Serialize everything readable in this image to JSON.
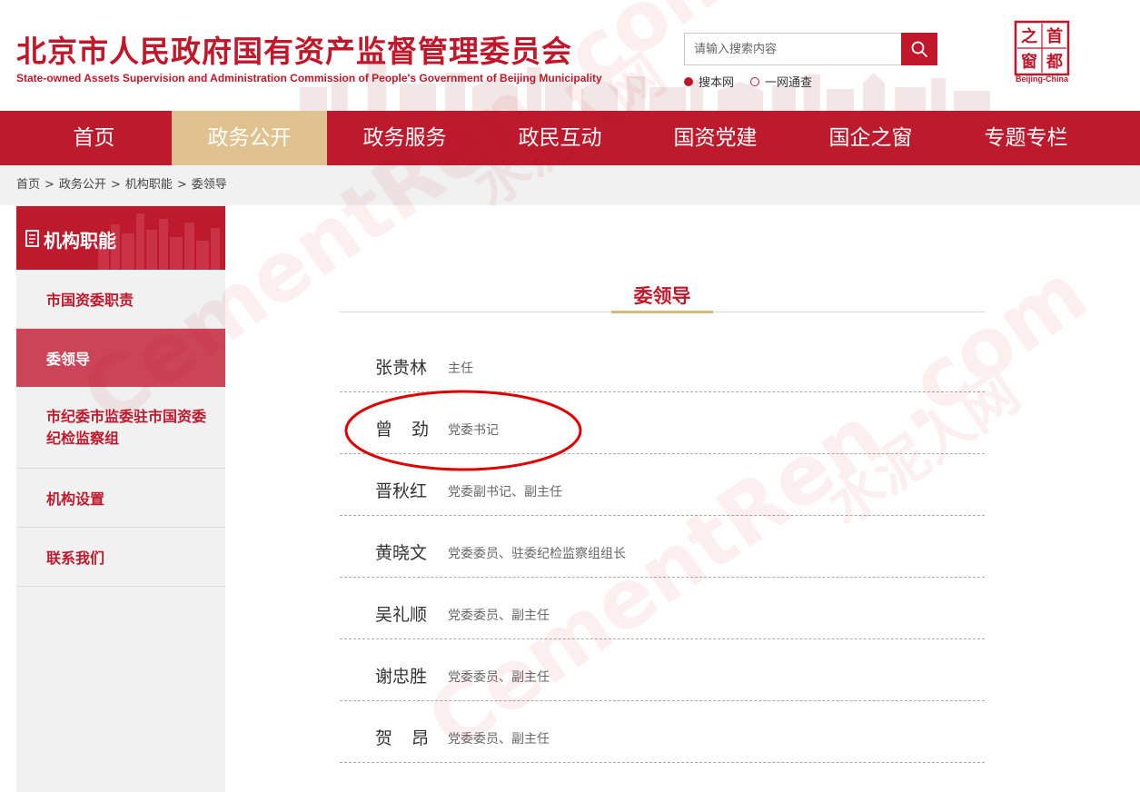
{
  "header": {
    "title_cn": "北京市人民政府国有资产监督管理委员会",
    "title_en": "State-owned Assets Supervision and Administration Commission of People's Government of Beijing Municipality",
    "search_placeholder": "请输入搜索内容",
    "scope_site": "搜本网",
    "scope_all": "一网通查",
    "logo_chars": [
      "首",
      "都",
      "之",
      "窗"
    ],
    "logo_caption": "Beijing-China"
  },
  "nav": {
    "items": [
      {
        "label": "首页"
      },
      {
        "label": "政务公开"
      },
      {
        "label": "政务服务"
      },
      {
        "label": "政民互动"
      },
      {
        "label": "国资党建"
      },
      {
        "label": "国企之窗"
      },
      {
        "label": "专题专栏"
      }
    ],
    "active_label": "政务公开"
  },
  "breadcrumb": {
    "items": [
      "首页",
      "政务公开",
      "机构职能",
      "委领导"
    ],
    "separator": ">"
  },
  "sidebar": {
    "heading": "机构职能",
    "items": [
      {
        "label": "市国资委职责"
      },
      {
        "label": "委领导"
      },
      {
        "label": "市纪委市监委驻市国资委纪检监察组"
      },
      {
        "label": "机构设置"
      },
      {
        "label": "联系我们"
      }
    ],
    "active_label": "委领导"
  },
  "main": {
    "title": "委领导",
    "leaders": [
      {
        "name": "张贵林",
        "title": "主任"
      },
      {
        "name": "曾劲",
        "title": "党委书记"
      },
      {
        "name": "晋秋红",
        "title": "党委副书记、副主任"
      },
      {
        "name": "黄晓文",
        "title": "党委委员、驻委纪检监察组组长"
      },
      {
        "name": "吴礼顺",
        "title": "党委委员、副主任"
      },
      {
        "name": "谢忠胜",
        "title": "党委委员、副主任"
      },
      {
        "name": "贺昂",
        "title": "党委委员、副主任"
      }
    ],
    "highlighted_leader": "曾劲"
  },
  "watermark": {
    "cn": "水泥人网",
    "en": "CementRen .com"
  },
  "colors": {
    "brand_red": "#bd1a2d",
    "nav_active_gold": "#dfc28f",
    "sidebar_active": "#cc4457",
    "highlight_circle": "#e00000"
  }
}
